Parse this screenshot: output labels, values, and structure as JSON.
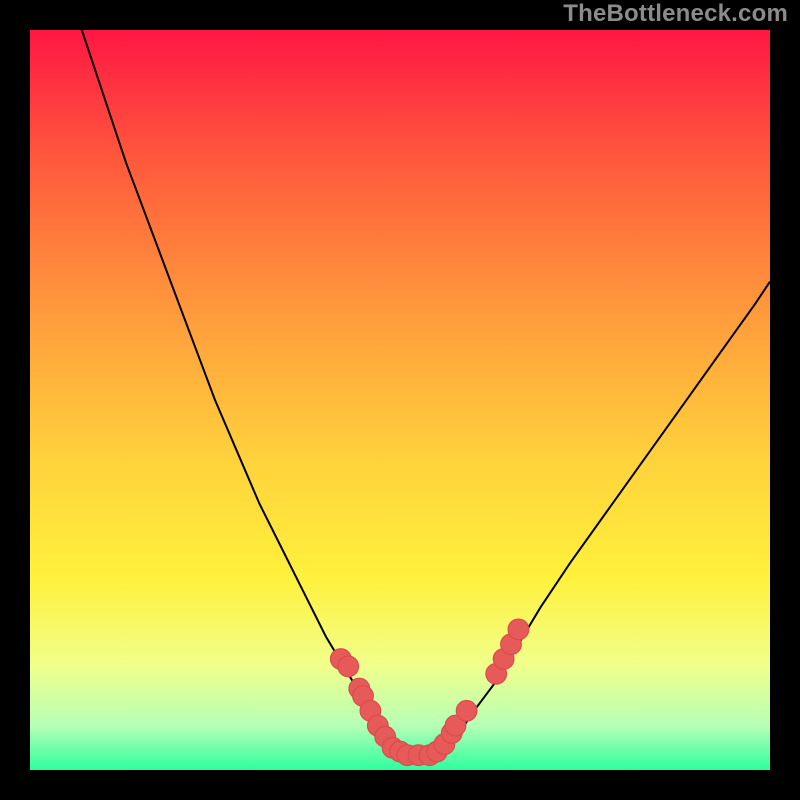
{
  "watermark": "TheBottleneck.com",
  "colors": {
    "frame": "#000000",
    "gradient_top": "#ff1744",
    "gradient_mid1": "#ff5a3c",
    "gradient_mid2": "#ff9a3c",
    "gradient_mid3": "#ffd23c",
    "gradient_mid4": "#fff13c",
    "gradient_low1": "#f0ff8c",
    "gradient_low2": "#b6ffb6",
    "gradient_bottom": "#2dff9e",
    "curve": "#000000",
    "marker_fill": "#e65a5a",
    "marker_stroke": "#d94a4a"
  },
  "chart_data": {
    "type": "line",
    "title": "",
    "xlabel": "",
    "ylabel": "",
    "xlim": [
      0,
      100
    ],
    "ylim": [
      0,
      100
    ],
    "series": [
      {
        "name": "bottleneck-curve",
        "x": [
          7,
          10,
          13,
          16,
          19,
          22,
          25,
          28,
          31,
          34,
          37,
          40,
          43,
          46,
          48,
          50,
          52,
          54,
          56,
          58,
          60,
          63,
          66,
          69,
          73,
          78,
          83,
          88,
          93,
          98,
          100
        ],
        "y": [
          100,
          91,
          82,
          74,
          66,
          58,
          50,
          43,
          36,
          30,
          24,
          18,
          13,
          8,
          5,
          3,
          2,
          2,
          3,
          5,
          8,
          12,
          17,
          22,
          28,
          35,
          42,
          49,
          56,
          63,
          66
        ]
      }
    ],
    "markers": [
      {
        "x": 42,
        "y": 15
      },
      {
        "x": 43,
        "y": 14
      },
      {
        "x": 44.5,
        "y": 11
      },
      {
        "x": 45,
        "y": 10
      },
      {
        "x": 46,
        "y": 8
      },
      {
        "x": 47,
        "y": 6
      },
      {
        "x": 48,
        "y": 4.5
      },
      {
        "x": 49,
        "y": 3
      },
      {
        "x": 50,
        "y": 2.5
      },
      {
        "x": 51,
        "y": 2
      },
      {
        "x": 52.5,
        "y": 2
      },
      {
        "x": 54,
        "y": 2
      },
      {
        "x": 55,
        "y": 2.5
      },
      {
        "x": 56,
        "y": 3.5
      },
      {
        "x": 57,
        "y": 5
      },
      {
        "x": 57.5,
        "y": 6
      },
      {
        "x": 59,
        "y": 8
      },
      {
        "x": 63,
        "y": 13
      },
      {
        "x": 64,
        "y": 15
      },
      {
        "x": 65,
        "y": 17
      },
      {
        "x": 66,
        "y": 19
      }
    ]
  }
}
